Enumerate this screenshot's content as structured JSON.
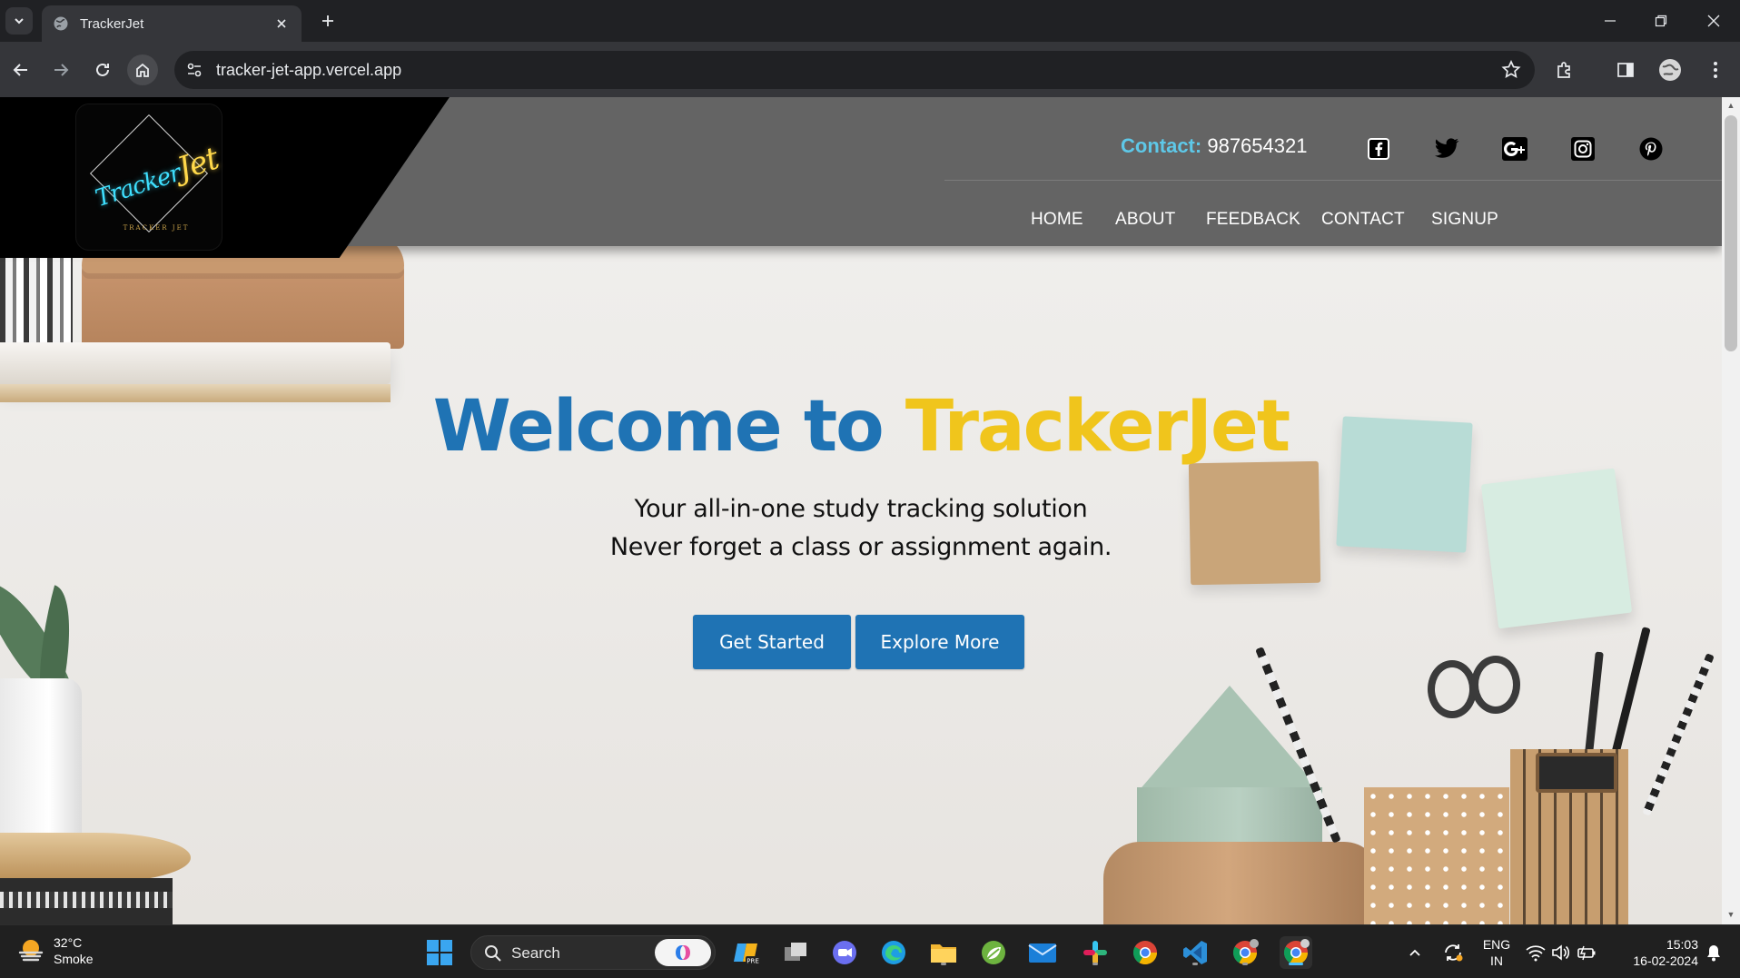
{
  "browser": {
    "tab_title": "TrackerJet",
    "url": "tracker-jet-app.vercel.app"
  },
  "header": {
    "contact_label": "Contact:",
    "contact_number": "987654321",
    "social": [
      "facebook-icon",
      "twitter-icon",
      "google-plus-icon",
      "instagram-icon",
      "pinterest-icon"
    ],
    "nav": [
      "HOME",
      "ABOUT",
      "FEEDBACK",
      "CONTACT",
      "SIGNUP"
    ]
  },
  "logo": {
    "script_a": "Tracker",
    "script_b": "Jet",
    "sub": "TRACKER JET"
  },
  "hero": {
    "title_part1": "Welcome to",
    "title_part2": "TrackerJet",
    "subtitle_line1": "Your all-in-one study tracking solution",
    "subtitle_line2": "Never forget a class or assignment again.",
    "button_primary": "Get Started",
    "button_secondary": "Explore More"
  },
  "colors": {
    "accent_blue": "#1f73b4",
    "accent_yellow": "#f0c51c",
    "contact_label": "#5ec8e8",
    "header_bg": "#646464"
  },
  "taskbar": {
    "temperature": "32°C",
    "weather": "Smoke",
    "search_label": "Search",
    "lang_line1": "ENG",
    "lang_line2": "IN",
    "time": "15:03",
    "date": "16-02-2024"
  }
}
